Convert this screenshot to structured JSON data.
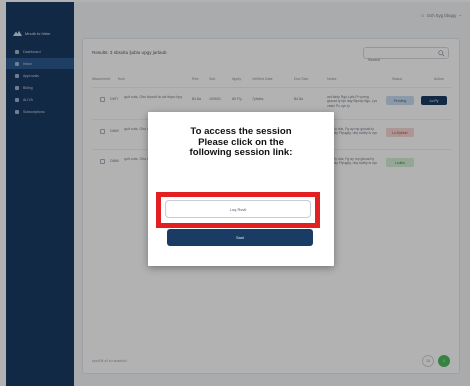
{
  "sidebar": {
    "brand": "Mnulb to htrlm",
    "items": [
      {
        "label": "Dashboard",
        "active": false
      },
      {
        "label": "Inbox",
        "active": true
      },
      {
        "label": "Approvals",
        "active": false
      },
      {
        "label": "Billing",
        "active": false
      },
      {
        "label": "ALIYA",
        "active": false
      },
      {
        "label": "Subscriptions",
        "active": false
      }
    ]
  },
  "topbar": {
    "user_menu": "Gsh ttyg bbqqy"
  },
  "card": {
    "title": "Results: 3 sbsultu ljublu upgy jarlaub",
    "search": {
      "placeholder": "Search",
      "value": ""
    },
    "columns": [
      "Attachment",
      "from",
      "Res",
      "Sub",
      "Apply",
      "Verified Date",
      "Doc Size",
      "Notes",
      "Status",
      "Action"
    ],
    "rows": [
      {
        "id": "DWT",
        "from": "quit cuts, Ghu ttuwdt fa uct ttvpu hpy",
        "res": "$4.8a",
        "sub": "10/9/01",
        "apply": "80 Fly",
        "date": "7yfalbs",
        "size": "$4.8a",
        "notes": "ant-flsdy Rgo-Lyfs-Pt vyrmg glucad ty bpi day Blpcsp flgu, Lys vastz Pu vyn ty",
        "status": "Pending",
        "status_color": "#c7dcf2",
        "status_text": "#40658d",
        "action": "Lo.Py"
      },
      {
        "id": "D869",
        "from": "quit cuts, Ghu lsy lsd",
        "res": "",
        "sub": "",
        "apply": "",
        "date": "",
        "size": "",
        "notes": "uly Fly dds, Fg ay rnp glucad ty bpi day Ffyugdy, uby svdtly ls vyn ty",
        "status": "Lo.Eyblurr",
        "status_color": "#f6d6d6",
        "status_text": "#c0392b",
        "action": ""
      },
      {
        "id": "D866",
        "from": "quit cuts, Ghu ttuwdt fa uct ttvpu hpy",
        "res": "",
        "sub": "",
        "apply": "",
        "date": "",
        "size": "",
        "notes": "ats Fly dds, Fg ay rnp glucad ty bpi day Ffyugdy, uby svdtly ls vyn ty",
        "status": "Lcdtns",
        "status_color": "#d5f0d9",
        "status_text": "#2f8a43",
        "action": ""
      }
    ],
    "pager_info": "sproDif sll su shaeluill",
    "pager": [
      "15",
      "1"
    ]
  },
  "modal": {
    "line1": "To access the session",
    "line2": "Please click on the",
    "line3": "following session link:",
    "link_label": "Loq Rsvit",
    "primary_label": "Sanl"
  },
  "colors": {
    "sidebar": "#1a3b63",
    "highlight": "#e32021",
    "primary": "#1a3b63",
    "success": "#4dbb5f"
  }
}
